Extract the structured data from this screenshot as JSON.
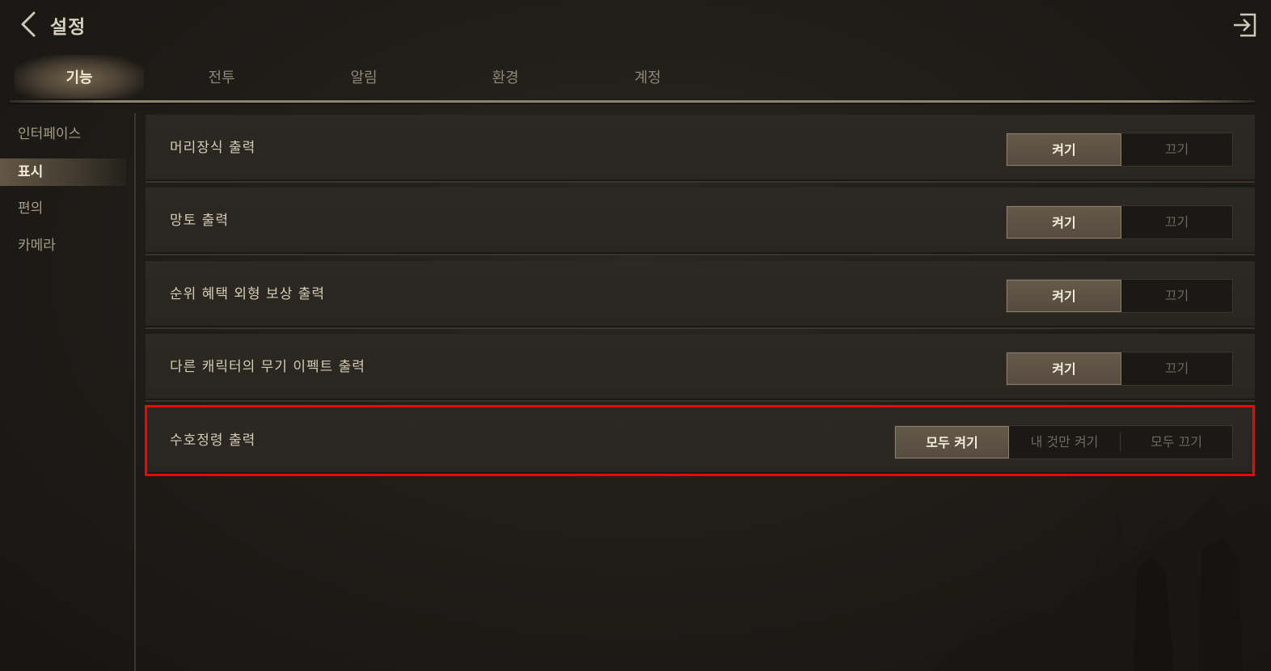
{
  "header": {
    "title": "설정"
  },
  "tabs": [
    {
      "label": "기능",
      "active": true
    },
    {
      "label": "전투",
      "active": false
    },
    {
      "label": "알림",
      "active": false
    },
    {
      "label": "환경",
      "active": false
    },
    {
      "label": "계정",
      "active": false
    }
  ],
  "sidebar": {
    "items": [
      {
        "label": "인터페이스",
        "active": false
      },
      {
        "label": "표시",
        "active": true
      },
      {
        "label": "편의",
        "active": false
      },
      {
        "label": "카메라",
        "active": false
      }
    ]
  },
  "settings": [
    {
      "label": "머리장식 출력",
      "options": [
        "켜기",
        "끄기"
      ],
      "selected": "켜기"
    },
    {
      "label": "망토 출력",
      "options": [
        "켜기",
        "끄기"
      ],
      "selected": "켜기"
    },
    {
      "label": "순위 혜택 외형 보상 출력",
      "options": [
        "켜기",
        "끄기"
      ],
      "selected": "켜기"
    },
    {
      "label": "다른 캐릭터의 무기 이펙트 출력",
      "options": [
        "켜기",
        "끄기"
      ],
      "selected": "켜기"
    },
    {
      "label": "수호정령 출력",
      "options": [
        "모두 켜기",
        "내 것만 켜기",
        "모두 끄기"
      ],
      "selected": "모두 켜기"
    }
  ],
  "icons": {
    "back": "chevron-left-icon",
    "exit": "exit-icon"
  },
  "colors": {
    "highlight": "#ff0000",
    "selected_bg": "#5d5346"
  }
}
